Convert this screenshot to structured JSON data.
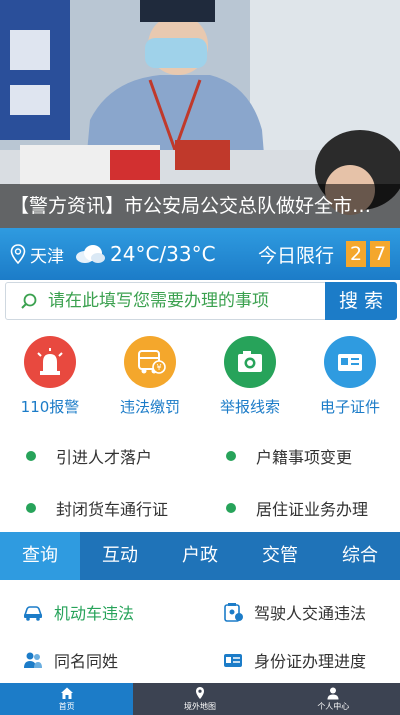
{
  "banner": {
    "caption": "【警方资讯】市公安局公交总队做好全市…"
  },
  "weather": {
    "city": "天津",
    "temperature": "24°C/33°C",
    "limit_label": "今日限行",
    "limit_numbers": [
      "2",
      "7"
    ],
    "icon": "cloud-icon"
  },
  "search": {
    "placeholder": "请在此填写您需要办理的事项",
    "button_label": "搜 索"
  },
  "quick_actions": [
    {
      "label": "110报警",
      "icon": "alarm-light-icon",
      "color": "#e8493f"
    },
    {
      "label": "违法缴罚",
      "icon": "truck-fine-icon",
      "color": "#f4a72c"
    },
    {
      "label": "举报线索",
      "icon": "camera-icon",
      "color": "#27a35a"
    },
    {
      "label": "电子证件",
      "icon": "id-card-icon",
      "color": "#2f9be0"
    }
  ],
  "services": [
    [
      "引进人才落户",
      "户籍事项变更"
    ],
    [
      "封闭货车通行证",
      "居住证业务办理"
    ]
  ],
  "tabs": [
    "查询",
    "互动",
    "户政",
    "交管",
    "综合"
  ],
  "query_items": [
    [
      "机动车违法",
      "驾驶人交通违法"
    ],
    [
      "同名同姓",
      "身份证办理进度"
    ]
  ],
  "bottom_nav": [
    "首页",
    "境外地图",
    "个人中心"
  ],
  "colors": {
    "primary": "#1c7cc8",
    "accent": "#2f9be0",
    "green": "#27a35a",
    "orange": "#f4a72c",
    "red": "#e8493f"
  }
}
